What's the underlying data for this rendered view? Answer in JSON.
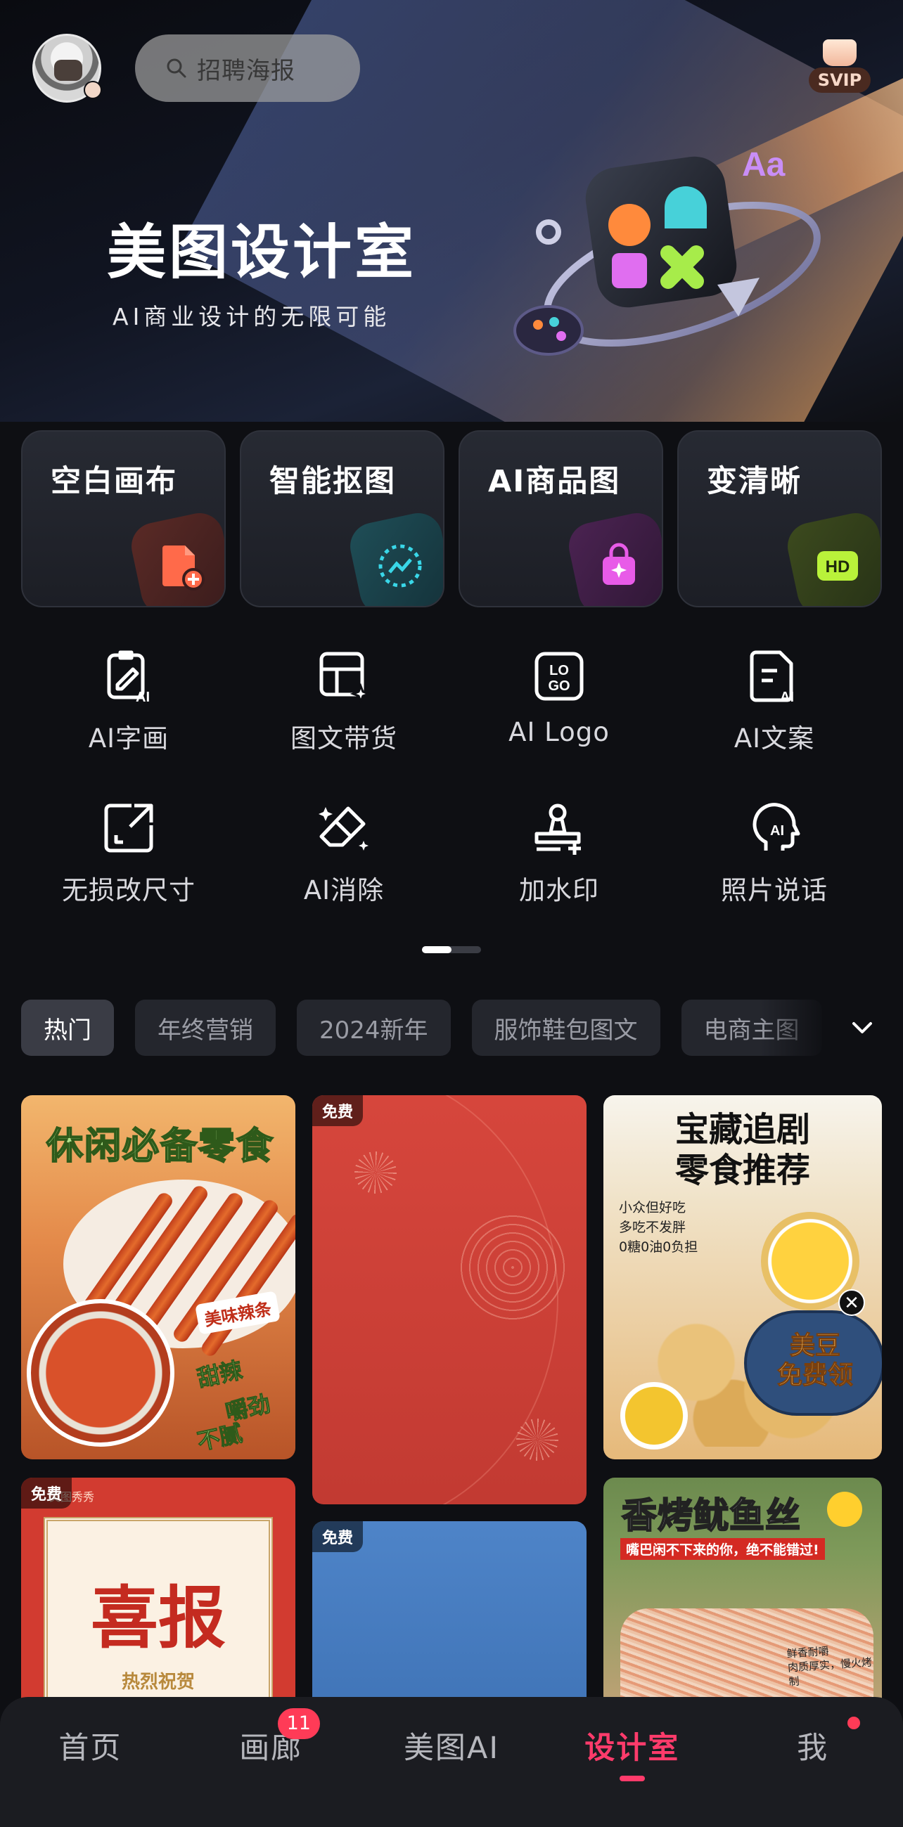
{
  "header": {
    "search_placeholder": "招聘海报",
    "svip_label": "SVIP"
  },
  "hero": {
    "title": "美图设计室",
    "subtitle": "AI商业设计的无限可能"
  },
  "feature_cards": [
    {
      "label": "空白画布",
      "icon": "file-plus-icon",
      "color": "#ff6a4a"
    },
    {
      "label": "智能抠图",
      "icon": "cutout-icon",
      "color": "#39d7e8"
    },
    {
      "label": "AI商品图",
      "icon": "shopping-bag-icon",
      "color": "#e85be8"
    },
    {
      "label": "变清晰",
      "icon": "hd-icon",
      "color": "#b9f23a"
    }
  ],
  "tools": [
    {
      "label": "AI字画",
      "icon": "ai-painting-icon"
    },
    {
      "label": "图文带货",
      "icon": "layout-sparkle-icon"
    },
    {
      "label": "AI Logo",
      "icon": "logo-icon"
    },
    {
      "label": "AI文案",
      "icon": "ai-copywriting-icon"
    },
    {
      "label": "无损改尺寸",
      "icon": "resize-icon"
    },
    {
      "label": "AI消除",
      "icon": "eraser-icon"
    },
    {
      "label": "加水印",
      "icon": "stamp-icon"
    },
    {
      "label": "照片说话",
      "icon": "talking-head-icon"
    }
  ],
  "pager": {
    "pages": 2,
    "current": 1
  },
  "categories": [
    "热门",
    "年终营销",
    "2024新年",
    "服饰鞋包图文",
    "电商主图"
  ],
  "templates": {
    "snack": {
      "title": "休闲必备零食",
      "tag": "美味辣条",
      "lines": [
        "甜辣",
        "嚼劲",
        "不腻"
      ]
    },
    "red_poster": {
      "badge": "免费"
    },
    "blue_poster": {
      "badge": "免费"
    },
    "good_news": {
      "badge": "免费",
      "brand": "美图秀秀",
      "title": "喜报",
      "subtitle": "热烈祝贺"
    },
    "drama_snack": {
      "title_line1": "宝藏追剧",
      "title_line2": "零食推荐",
      "points": [
        "小众但好吃",
        "多吃不发胖",
        "0糖0油0负担"
      ],
      "coupon_line1": "美豆",
      "coupon_line2": "免费领",
      "close": "✕"
    },
    "squid": {
      "title": "香烤鱿鱼丝",
      "subtitle": "嘴巴闲不下来的你，绝不能错过!",
      "note_line1": "鲜香耐嚼",
      "note_line2": "肉质厚实，慢火烤制"
    }
  },
  "bottom_nav": [
    {
      "label": "首页"
    },
    {
      "label": "画廊",
      "badge": "11"
    },
    {
      "label": "美图AI"
    },
    {
      "label": "设计室",
      "active": true
    },
    {
      "label": "我",
      "dot": true
    }
  ],
  "colors": {
    "accent": "#ff3b6b",
    "background": "#0e0f13",
    "card": "#22242b"
  }
}
